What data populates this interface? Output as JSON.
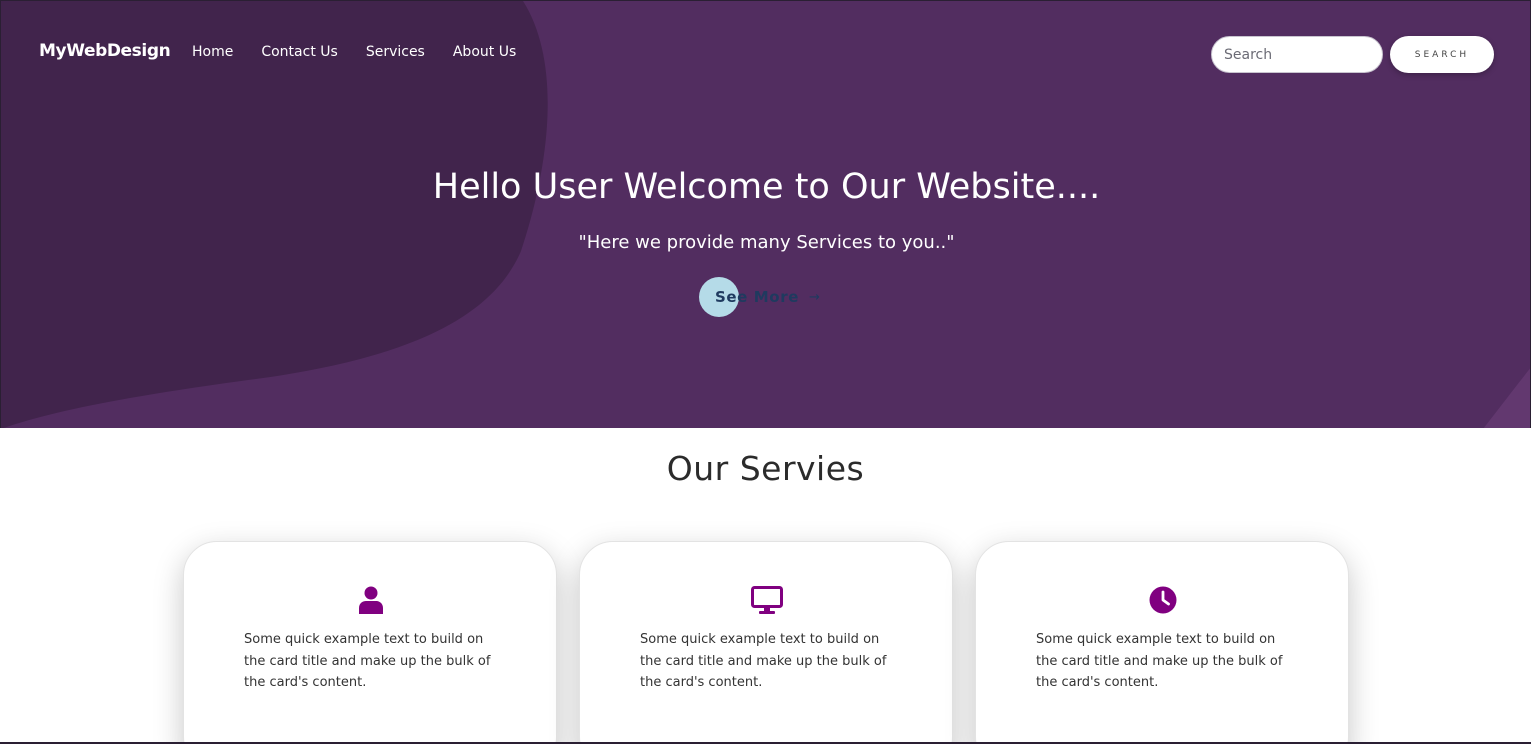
{
  "navbar": {
    "brand": "MyWebDesign",
    "links": [
      "Home",
      "Contact Us",
      "Services",
      "About Us"
    ],
    "search_placeholder": "Search",
    "search_button": "SEARCH"
  },
  "hero": {
    "title": "Hello User Welcome to Our Website....",
    "subtitle": "\"Here we provide many Services to you..\"",
    "cta_label": "See More",
    "cta_arrow": "→"
  },
  "services": {
    "heading": "Our Servies",
    "cards": [
      {
        "icon": "user-icon",
        "text": "Some quick example text to build on the card title and make up the bulk of the card's content."
      },
      {
        "icon": "desktop-icon",
        "text": "Some quick example text to build on the card title and make up the bulk of the card's content."
      },
      {
        "icon": "clock-icon",
        "text": "Some quick example text to build on the card title and make up the bulk of the card's content."
      }
    ]
  },
  "colors": {
    "hero_bg": "#522d60",
    "hero_blob": "#41244c",
    "hero_corner": "#62386f",
    "icon_purple": "#800080",
    "cta_circle": "#b5dbe8"
  }
}
